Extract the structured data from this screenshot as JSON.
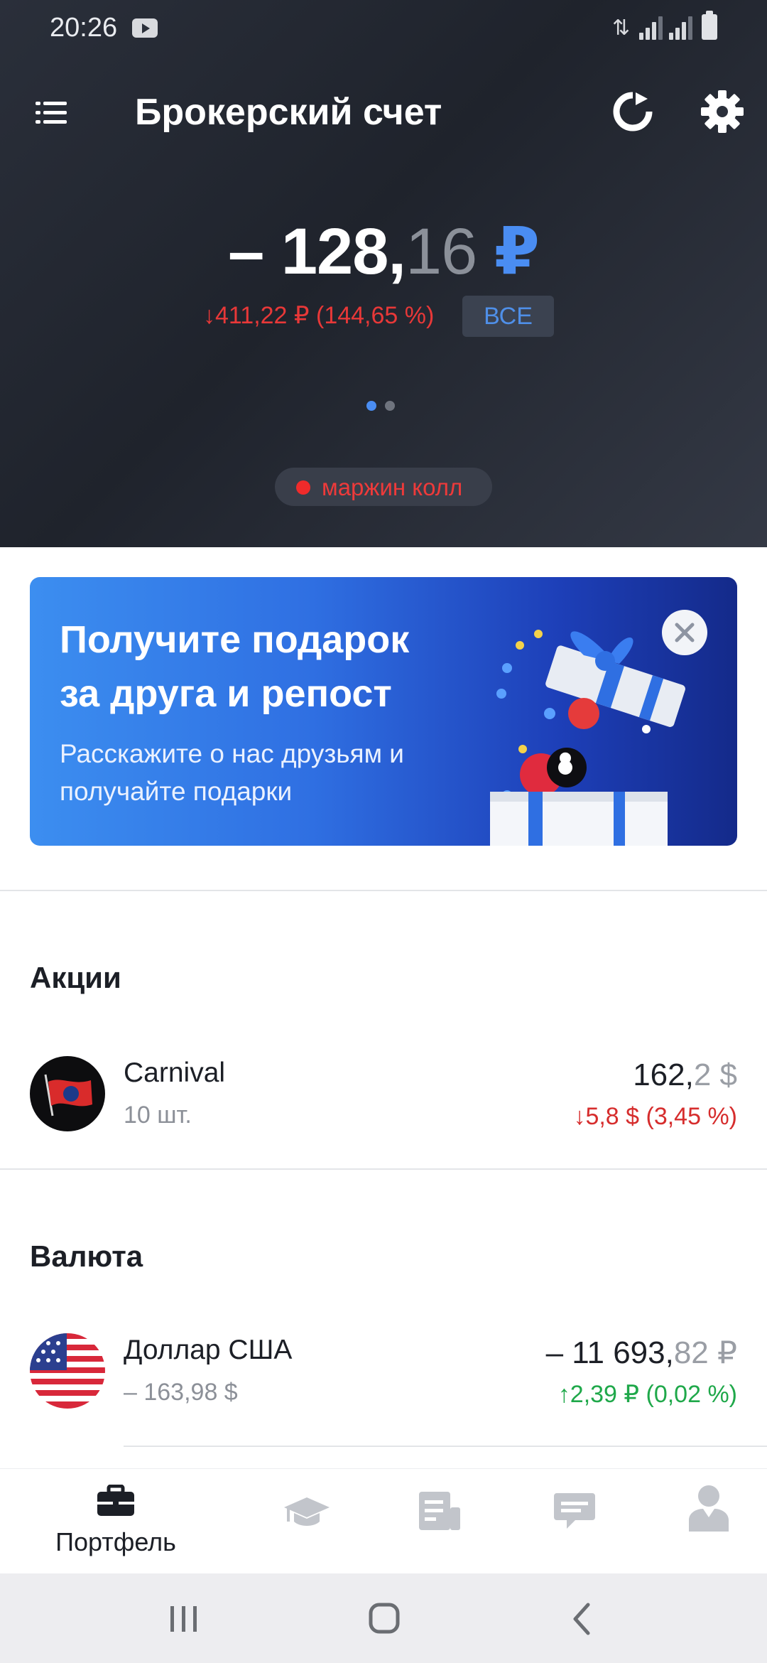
{
  "status_bar": {
    "time": "20:26",
    "icons": [
      "youtube-icon",
      "data-icon",
      "signal-icon",
      "signal-icon",
      "battery-icon"
    ]
  },
  "header": {
    "title": "Брокерский счет",
    "icons": [
      "menu-icon",
      "refresh-icon",
      "settings-icon"
    ]
  },
  "balance": {
    "whole": "– 128,",
    "fraction": "16",
    "currency": "₽",
    "change": "↓411,22 ₽ (144,65 %)",
    "period_button": "ВСЕ",
    "pager": {
      "pages": 2,
      "active": 1
    }
  },
  "margin_call": {
    "label": "маржин колл"
  },
  "promo": {
    "title": "Получите подарок за друга и репост",
    "subtitle": "Расскажите о нас друзьям и получайте подарки"
  },
  "sections": {
    "stocks": {
      "title": "Акции",
      "items": [
        {
          "name": "Carnival",
          "quantity": "10 шт.",
          "value_whole": "162,",
          "value_fraction": "2 $",
          "change": "↓5,8 $ (3,45 %)"
        }
      ]
    },
    "currency": {
      "title": "Валюта",
      "items": [
        {
          "name": "Доллар США",
          "quantity": "– 163,98 $",
          "value_whole": "– 11 693,",
          "value_fraction": "82 ₽",
          "change": "↑2,39 ₽ (0,02 %)"
        }
      ]
    }
  },
  "bottom_nav": {
    "items": [
      {
        "label": "Портфель",
        "icon": "briefcase-icon",
        "active": true
      },
      {
        "label": "",
        "icon": "graduation-cap-icon",
        "active": false
      },
      {
        "label": "",
        "icon": "news-icon",
        "active": false
      },
      {
        "label": "",
        "icon": "chat-icon",
        "active": false
      },
      {
        "label": "",
        "icon": "profile-icon",
        "active": false
      }
    ]
  },
  "system_nav": {
    "icons": [
      "recent-apps-icon",
      "home-icon",
      "back-icon"
    ]
  },
  "colors": {
    "accent_blue": "#4a8df2",
    "negative_red": "#d62d2d",
    "positive_green": "#1fa84a",
    "header_bg": "#252a34"
  }
}
